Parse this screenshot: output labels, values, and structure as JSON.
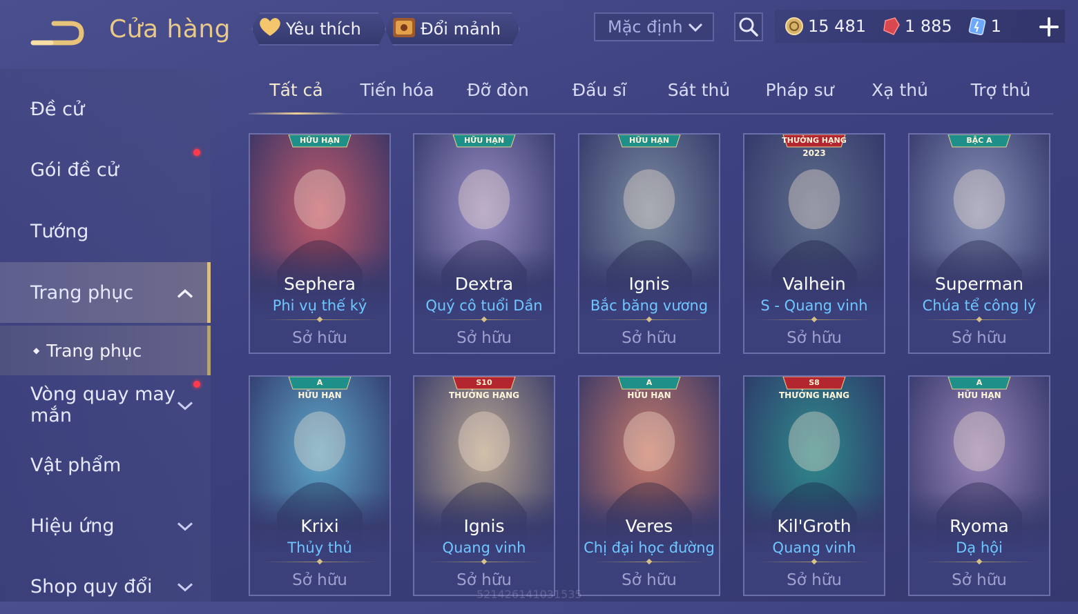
{
  "header": {
    "title": "Cửa hàng",
    "favorites_label": "Yêu thích",
    "exchange_label": "Đổi mảnh",
    "sort_value": "Mặc định",
    "gold": "15 481",
    "vouchers": "1 885",
    "tickets": "1"
  },
  "sidebar": {
    "items": [
      {
        "label": "Đề cử"
      },
      {
        "label": "Gói đề cử"
      },
      {
        "label": "Tướng"
      },
      {
        "label": "Trang phục"
      },
      {
        "label": "Vòng quay may mắn"
      },
      {
        "label": "Vật phẩm"
      },
      {
        "label": "Hiệu ứng"
      },
      {
        "label": "Shop quy đổi"
      }
    ],
    "sub_item": "Trang phục"
  },
  "tabs": [
    "Tất cả",
    "Tiến hóa",
    "Đỡ đòn",
    "Đấu sĩ",
    "Sát thủ",
    "Pháp sư",
    "Xạ thủ",
    "Trợ thủ"
  ],
  "cards": [
    {
      "hero": "Sephera",
      "skin": "Phi vụ thế kỷ",
      "status": "Sở hữu",
      "badge": "HỮU HẠN",
      "color": "#c25a6a"
    },
    {
      "hero": "Dextra",
      "skin": "Quý cô tuổi Dần",
      "status": "Sở hữu",
      "badge": "HỮU HẠN",
      "color": "#9a8fc4"
    },
    {
      "hero": "Ignis",
      "skin": "Bắc băng vương",
      "status": "Sở hữu",
      "badge": "HỮU HẠN",
      "color": "#7b8ba0"
    },
    {
      "hero": "Valhein",
      "skin": "S - Quang vinh",
      "status": "Sở hữu",
      "badge": "THƯỞNG HẠNG",
      "badge2": "2023",
      "color": "#5f6e8c"
    },
    {
      "hero": "Superman",
      "skin": "Chúa tể công lý",
      "status": "Sở hữu",
      "badge": "BẬC A",
      "color": "#8a94b8"
    },
    {
      "hero": "Krixi",
      "skin": "Thủy thủ",
      "status": "Sở hữu",
      "badge": "A",
      "badge2": "HỮU HẠN",
      "color": "#5fa7c9"
    },
    {
      "hero": "Ignis",
      "skin": "Quang vinh",
      "status": "Sở hữu",
      "badge": "S10",
      "badge2": "THƯỞNG HẠNG",
      "color": "#b9a792"
    },
    {
      "hero": "Veres",
      "skin": "Chị đại học đường",
      "status": "Sở hữu",
      "badge": "A",
      "badge2": "HỮU HẠN",
      "color": "#c77a6a"
    },
    {
      "hero": "Kil'Groth",
      "skin": "Quang vinh",
      "status": "Sở hữu",
      "badge": "S8",
      "badge2": "THƯỞNG HẠNG",
      "color": "#2f8a8c"
    },
    {
      "hero": "Ryoma",
      "skin": "Dạ hội",
      "status": "Sở hữu",
      "badge": "A",
      "badge2": "HỮU HẠN",
      "color": "#9a86b8"
    }
  ],
  "watermark": "521426141031535"
}
